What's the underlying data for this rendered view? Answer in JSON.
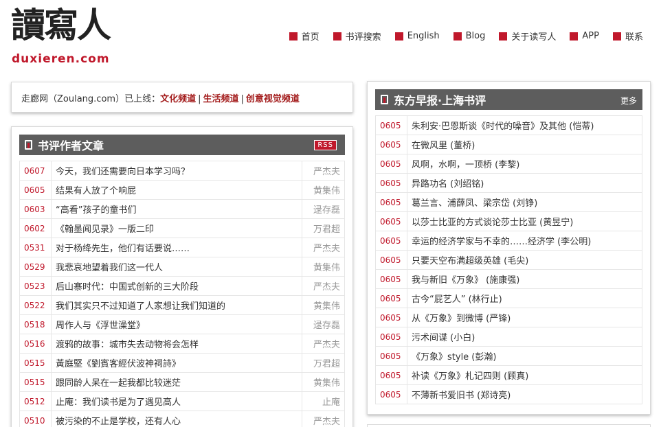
{
  "logo": {
    "cn": "讀寫人",
    "en": "duxieren.com"
  },
  "nav": [
    {
      "label": "首页",
      "icon": "red-square-icon"
    },
    {
      "label": "书评搜索",
      "icon": "red-square-icon"
    },
    {
      "label": "English",
      "icon": "red-square-icon"
    },
    {
      "label": "Blog",
      "icon": "red-square-icon"
    },
    {
      "label": "关于读写人",
      "icon": "red-square-icon"
    },
    {
      "label": "APP",
      "icon": "red-square-icon"
    },
    {
      "label": "联系",
      "icon": "red-square-icon"
    }
  ],
  "notice": {
    "text": "走廊网（Zoulang.com）已上线：",
    "links": [
      "文化频道",
      "生活频道",
      "创意视觉频道"
    ],
    "sep": "|"
  },
  "left_box": {
    "title": "书评作者文章",
    "rss": "RSS",
    "rows": [
      {
        "date": "0607",
        "title": "今天，我们还需要向日本学习吗？",
        "author": "严杰夫"
      },
      {
        "date": "0605",
        "title": "结果有人放了个响屁",
        "author": "黄集伟"
      },
      {
        "date": "0603",
        "title": "“高看”孩子的童书们",
        "author": "逯存磊"
      },
      {
        "date": "0602",
        "title": "《翰墨闻见录》一版二印",
        "author": "万君超"
      },
      {
        "date": "0531",
        "title": "对于杨绛先生，他们有话要说……",
        "author": "严杰夫"
      },
      {
        "date": "0529",
        "title": "我悲哀地望着我们这一代人",
        "author": "黄集伟"
      },
      {
        "date": "0523",
        "title": "后山寨时代：中国式创新的三大阶段",
        "author": "严杰夫"
      },
      {
        "date": "0522",
        "title": "我们其实只不过知道了人家想让我们知道的",
        "author": "黄集伟"
      },
      {
        "date": "0518",
        "title": "周作人与《浮世澡堂》",
        "author": "逯存磊"
      },
      {
        "date": "0516",
        "title": "渡鸦的故事：城市失去动物将会怎样",
        "author": "严杰夫"
      },
      {
        "date": "0515",
        "title": "黃庭堅《劉賓客經伏波神祠詩》",
        "author": "万君超"
      },
      {
        "date": "0515",
        "title": "跟同龄人呆在一起我都比较迷茫",
        "author": "黄集伟"
      },
      {
        "date": "0512",
        "title": "止庵：我们读书是为了遇见高人",
        "author": "止庵"
      },
      {
        "date": "0510",
        "title": "被污染的不止是学校，还有人心",
        "author": "严杰夫"
      }
    ]
  },
  "right_box": {
    "title": "东方早报·上海书评",
    "more": "更多",
    "rows": [
      {
        "date": "0605",
        "title": "朱利安·巴恩斯谈《时代的噪音》及其他 (恺蒂)"
      },
      {
        "date": "0605",
        "title": "在微风里 (董桥)"
      },
      {
        "date": "0605",
        "title": "风啊，水啊，一顶桥 (李黎)"
      },
      {
        "date": "0605",
        "title": "异路功名 (刘绍铭)"
      },
      {
        "date": "0605",
        "title": "葛兰言、浦薛凤、梁宗岱 (刘铮)"
      },
      {
        "date": "0605",
        "title": "以莎士比亚的方式谈论莎士比亚 (黄昱宁)"
      },
      {
        "date": "0605",
        "title": "幸运的经济学家与不幸的……经济学 (李公明)"
      },
      {
        "date": "0605",
        "title": "只要天空布满超级英雄 (毛尖)"
      },
      {
        "date": "0605",
        "title": "我与新旧《万象》 (施康强)"
      },
      {
        "date": "0605",
        "title": "古今“屁艺人” (林行止)"
      },
      {
        "date": "0605",
        "title": "从《万象》到微博 (严锋)"
      },
      {
        "date": "0605",
        "title": "污术间谍 (小白)"
      },
      {
        "date": "0605",
        "title": "《万象》style (彭瀚)"
      },
      {
        "date": "0605",
        "title": "补读《万象》札记四则 (顾真)"
      },
      {
        "date": "0605",
        "title": "不薄新书爱旧书 (郑诗亮)"
      }
    ]
  },
  "colors": {
    "accent": "#c0182b",
    "header_bar": "#5d5d5d",
    "muted": "#999999"
  }
}
